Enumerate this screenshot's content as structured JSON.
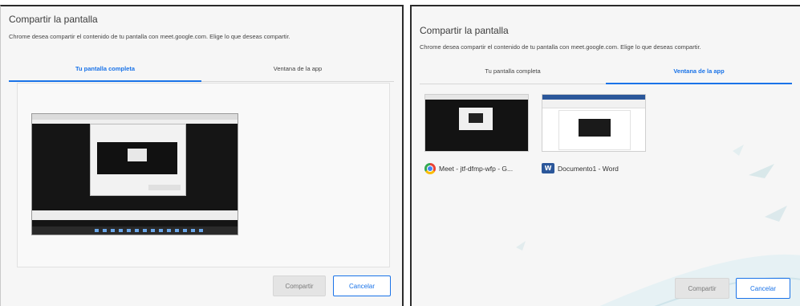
{
  "left_dialog": {
    "title": "Compartir la pantalla",
    "description": "Chrome desea compartir el contenido de tu pantalla con meet.google.com. Elige lo que deseas compartir.",
    "tabs": [
      {
        "label": "Tu pantalla completa",
        "active": true
      },
      {
        "label": "Ventana de la app",
        "active": false
      }
    ],
    "buttons": {
      "share": "Compartir",
      "cancel": "Cancelar"
    }
  },
  "right_dialog": {
    "title": "Compartir la pantalla",
    "description": "Chrome desea compartir el contenido de tu pantalla con meet.google.com. Elige lo que deseas compartir.",
    "tabs": [
      {
        "label": "Tu pantalla completa",
        "active": false
      },
      {
        "label": "Ventana de la app",
        "active": true
      }
    ],
    "windows": [
      {
        "label": "Meet - jtf-dfmp-wfp - G...",
        "icon": "chrome-icon"
      },
      {
        "label": "Documento1 - Word",
        "icon": "word-icon"
      }
    ],
    "buttons": {
      "share": "Compartir",
      "cancel": "Cancelar"
    }
  },
  "colors": {
    "accent": "#1a73e8",
    "dialog_bg": "#f6f6f6",
    "disabled_button": "#e4e4e4"
  }
}
